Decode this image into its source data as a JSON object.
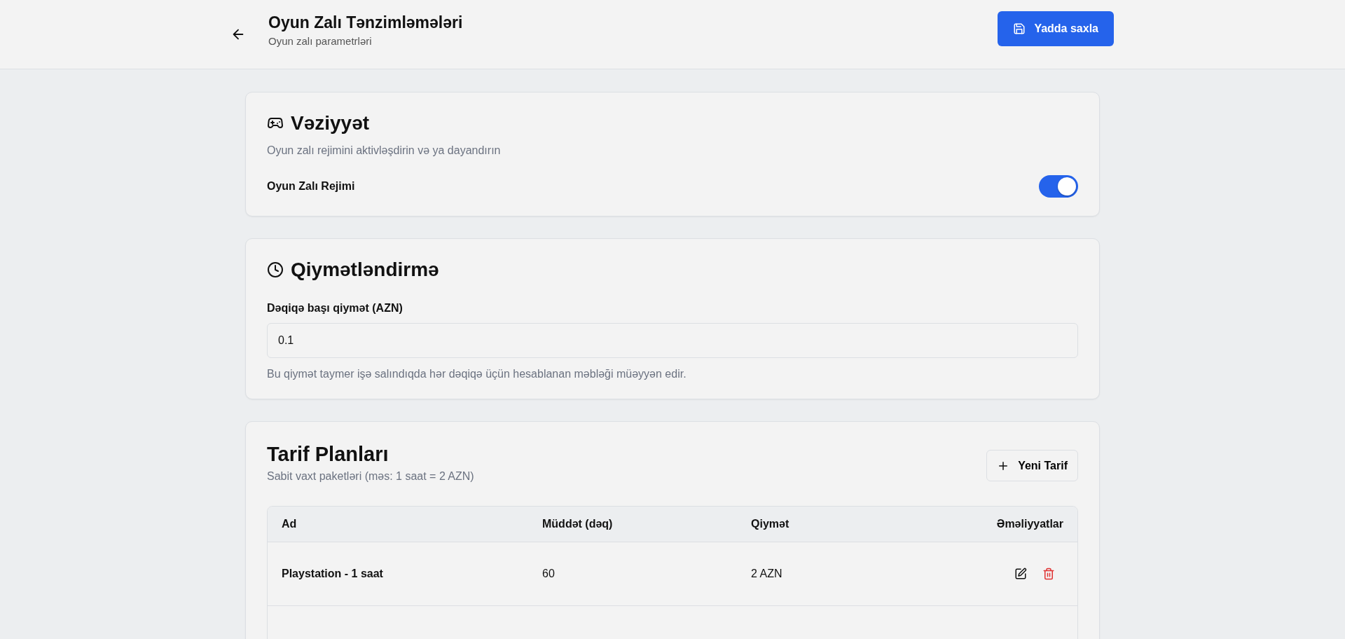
{
  "header": {
    "title": "Oyun Zalı Tənzimləmələri",
    "subtitle": "Oyun zalı parametrləri",
    "save_button": "Yadda saxla"
  },
  "status_card": {
    "title": "Vəziyyət",
    "description": "Oyun zalı rejimini aktivləşdirin və ya dayandırın",
    "toggle": {
      "label": "Oyun Zalı Rejimi",
      "on": true
    }
  },
  "pricing_card": {
    "title": "Qiymətləndirmə",
    "field": {
      "label": "Dəqiqə başı qiymət (AZN)",
      "value": "0.1"
    },
    "help": "Bu qiymət taymer işə salındıqda hər dəqiqə üçün hesablanan məbləği müəyyən edir."
  },
  "plans_card": {
    "title": "Tarif Planları",
    "description": "Sabit vaxt paketləri (məs: 1 saat = 2 AZN)",
    "add_button": "Yeni Tarif",
    "table": {
      "columns": [
        "Ad",
        "Müddət (dəq)",
        "Qiymət",
        "Əməliyyatlar"
      ],
      "rows": [
        {
          "name": "Playstation - 1 saat",
          "duration": "60",
          "price": "2 AZN"
        }
      ]
    }
  }
}
